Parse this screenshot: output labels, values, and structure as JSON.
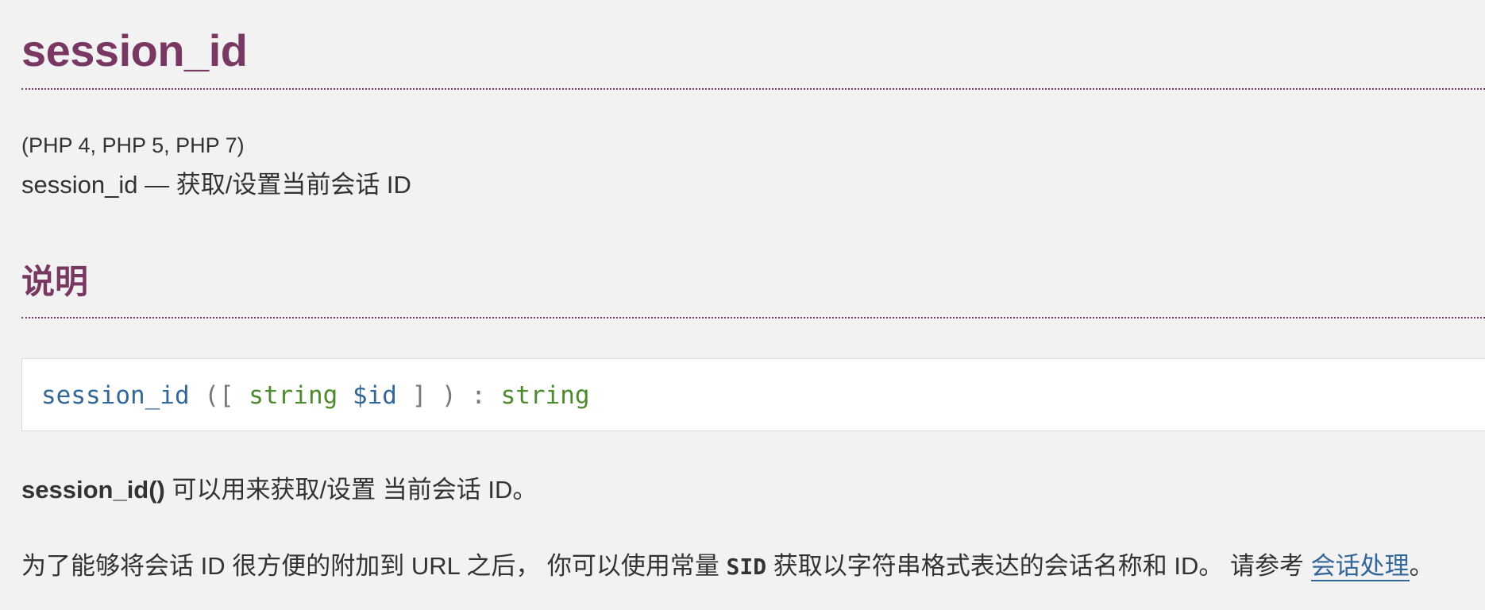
{
  "refentry": {
    "title": "session_id",
    "versions": "(PHP 4, PHP 5, PHP 7)",
    "refpurpose": "session_id — 获取/设置当前会话 ID"
  },
  "description": {
    "heading": "说明",
    "synopsis": {
      "method_name": "session_id",
      "open": " ([ ",
      "param_type": "string",
      "param_name": "$id",
      "close": " ] ) : ",
      "return_type": "string"
    },
    "para1": {
      "function": "session_id()",
      "text": " 可以用来获取/设置 当前会话 ID。"
    },
    "para2": {
      "text_before": "为了能够将会话 ID 很方便的附加到 URL 之后， 你可以使用常量 ",
      "constant": "SID",
      "text_middle": " 获取以字符串格式表达的会话名称和 ID。 请参考 ",
      "link": "会话处理",
      "text_after": "。"
    }
  }
}
